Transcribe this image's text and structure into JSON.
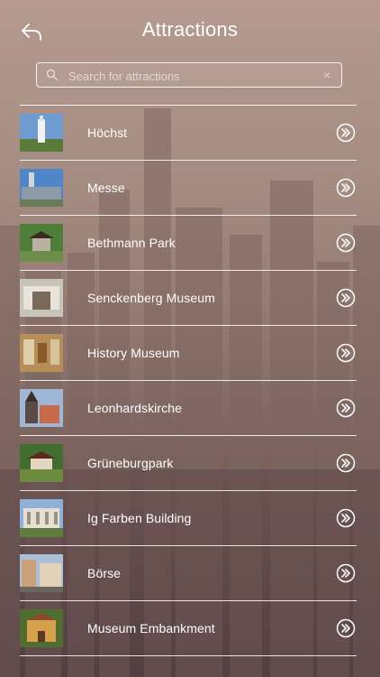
{
  "header": {
    "title": "Attractions"
  },
  "search": {
    "placeholder": "Search for attractions",
    "clear_symbol": "×"
  },
  "attractions": [
    {
      "name": "Höchst",
      "thumb": "tower-icon"
    },
    {
      "name": "Messe",
      "thumb": "building-icon"
    },
    {
      "name": "Bethmann Park",
      "thumb": "pagoda-icon"
    },
    {
      "name": "Senckenberg Museum",
      "thumb": "hall-icon"
    },
    {
      "name": "History Museum",
      "thumb": "gallery-icon"
    },
    {
      "name": "Leonhardskirche",
      "thumb": "church-icon"
    },
    {
      "name": "Grüneburgpark",
      "thumb": "pavilion-icon"
    },
    {
      "name": "Ig Farben Building",
      "thumb": "facade-icon"
    },
    {
      "name": "Börse",
      "thumb": "street-icon"
    },
    {
      "name": "Museum Embankment",
      "thumb": "villa-icon"
    }
  ],
  "colors": {
    "text": "#ffffff",
    "accent_border": "#ffffff"
  }
}
